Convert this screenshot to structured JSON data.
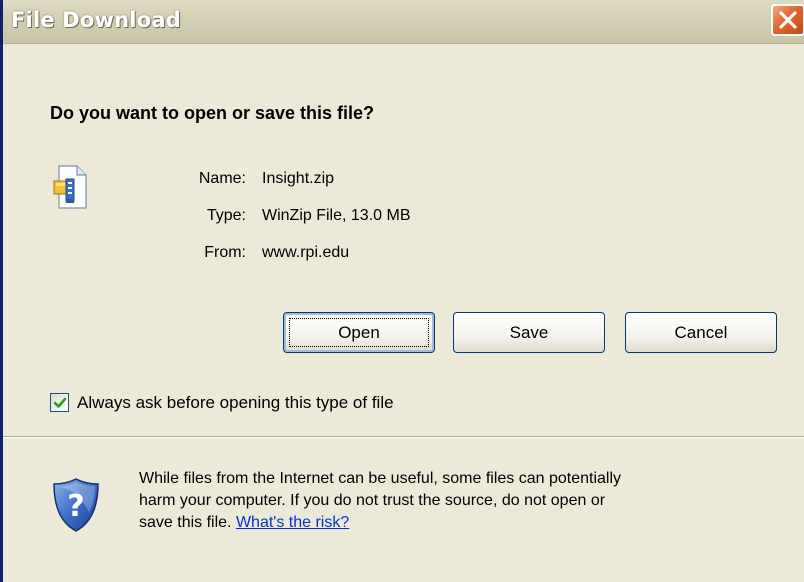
{
  "window": {
    "title": "File Download"
  },
  "dialog": {
    "question": "Do you want to open or save this file?",
    "file": {
      "name_label": "Name:",
      "name_value": "Insight.zip",
      "type_label": "Type:",
      "type_value": "WinZip File, 13.0 MB",
      "from_label": "From:",
      "from_value": "www.rpi.edu",
      "icon": "zip-file-icon"
    },
    "buttons": {
      "open": "Open",
      "save": "Save",
      "cancel": "Cancel"
    },
    "always_ask": {
      "label": "Always ask before opening this type of file",
      "checked": true
    },
    "warning": {
      "icon": "shield-question-icon",
      "line1": "While files from the Internet can be useful, some files can potentially",
      "line2": "harm your computer. If you do not trust the source, do not open or",
      "line3_prefix": "save this file. ",
      "link": "What's the risk?"
    }
  },
  "colors": {
    "window_bg": "#ece9d8",
    "link": "#0033cc",
    "close_button": "#e0662f"
  }
}
